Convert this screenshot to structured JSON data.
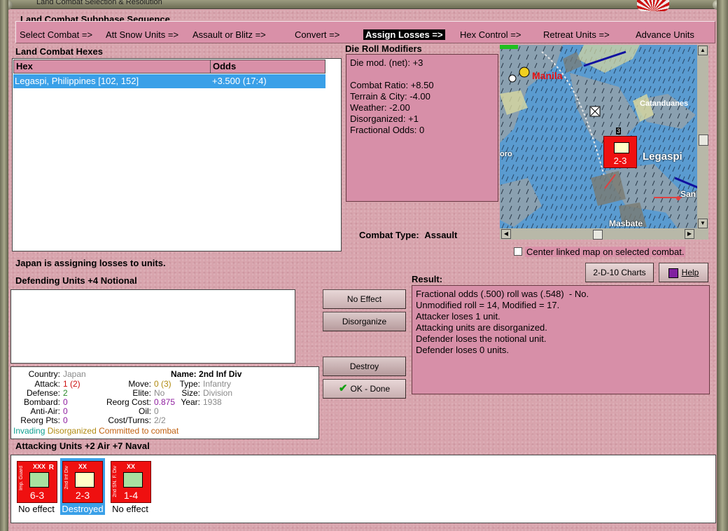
{
  "window": {
    "title": "Land Combat Selection & Resolution"
  },
  "sequence": {
    "title": "Land Combat Subphase Sequence",
    "steps": [
      "Select Combat =>",
      "Att Snow Units =>",
      "Assault or Blitz =>",
      "Convert =>",
      "Assign Losses =>",
      "Hex Control =>",
      "Retreat Units =>",
      "Advance Units"
    ],
    "active_index": 4
  },
  "hexes": {
    "title": "Land Combat Hexes",
    "columns": [
      "Hex",
      "Odds"
    ],
    "rows": [
      {
        "hex": "Legaspi, Philippines [102, 152]",
        "odds": "+3.500 (17:4)"
      }
    ]
  },
  "modifiers": {
    "title": "Die Roll Modifiers",
    "net": "Die mod. (net): +3",
    "lines": [
      "Combat Ratio: +8.50",
      "Terrain & City: -4.00",
      "Weather: -2.00",
      "Disorganized: +1",
      "Fractional Odds: 0"
    ]
  },
  "map": {
    "labels": {
      "manila": "Manila",
      "catanduanes": "Catanduanes",
      "legaspi": "Legaspi",
      "masbate": "Masbate",
      "san": "San",
      "oro": "oro",
      "stack_count": "3",
      "unit_value": "2-3"
    }
  },
  "combat_type": {
    "label": "Combat Type:",
    "value": "Assault"
  },
  "center_map": {
    "label": "Center linked map on selected combat.",
    "checked": false
  },
  "status": "Japan is assigning losses to units.",
  "defending": {
    "title": "Defending Units +4 Notional"
  },
  "buttons": {
    "no_effect": "No Effect",
    "disorganize": "Disorganize",
    "destroy": "Destroy",
    "ok_done": "OK - Done",
    "charts": "2-D-10 Charts",
    "help": "Help"
  },
  "result": {
    "title": "Result:",
    "lines": [
      "Fractional odds (.500) roll was (.548)  - No.",
      "Unmodified roll = 14, Modified = 17.",
      "Attacker loses 1 unit.",
      "Attacking units are disorganized.",
      "Defender loses the notional unit.",
      "Defender loses 0 units."
    ]
  },
  "unit_info": {
    "country_label": "Country:",
    "country": "Japan",
    "attack_label": "Attack:",
    "attack": "1 (2)",
    "defense_label": "Defense:",
    "defense": "2",
    "bombard_label": "Bombard:",
    "bombard": "0",
    "antiair_label": "Anti-Air:",
    "antiair": "0",
    "reorgpts_label": "Reorg Pts:",
    "reorgpts": "0",
    "move_label": "Move:",
    "move": "0 (3)",
    "elite_label": "Elite:",
    "elite": "No",
    "reorgcost_label": "Reorg Cost:",
    "reorgcost": "0.875",
    "oil_label": "Oil:",
    "oil": "0",
    "costturns_label": "Cost/Turns:",
    "costturns": "2/2",
    "name_label": "Name:",
    "name": "2nd Inf Div",
    "type_label": "Type:",
    "type": "Infantry",
    "size_label": "Size:",
    "size": "Division",
    "year_label": "Year:",
    "year": "1938",
    "flags": [
      "Invading",
      "Disorganized",
      "Committed to combat"
    ],
    "colors": {
      "value_grey": "#8a8a8a",
      "attack_red": "#cc1010",
      "green": "#2a8a2a",
      "gold": "#b08a10",
      "purple": "#9020a0",
      "teal": "#10a090",
      "orange": "#c06010"
    }
  },
  "attacking": {
    "title": "Attacking Units +2 Air +7 Naval",
    "units": [
      {
        "side_text": "Imp. Guard",
        "size": "XXX",
        "corner": "R",
        "value": "6-3",
        "status": "No effect",
        "selected": false
      },
      {
        "side_text": "2nd Inf Div",
        "size": "XX",
        "corner": "",
        "value": "2-3",
        "status": "Destroyed",
        "selected": true
      },
      {
        "side_text": "2nd SN. F. Div",
        "size": "XX",
        "corner": "",
        "value": "1-4",
        "status": "No effect",
        "selected": false
      }
    ]
  }
}
